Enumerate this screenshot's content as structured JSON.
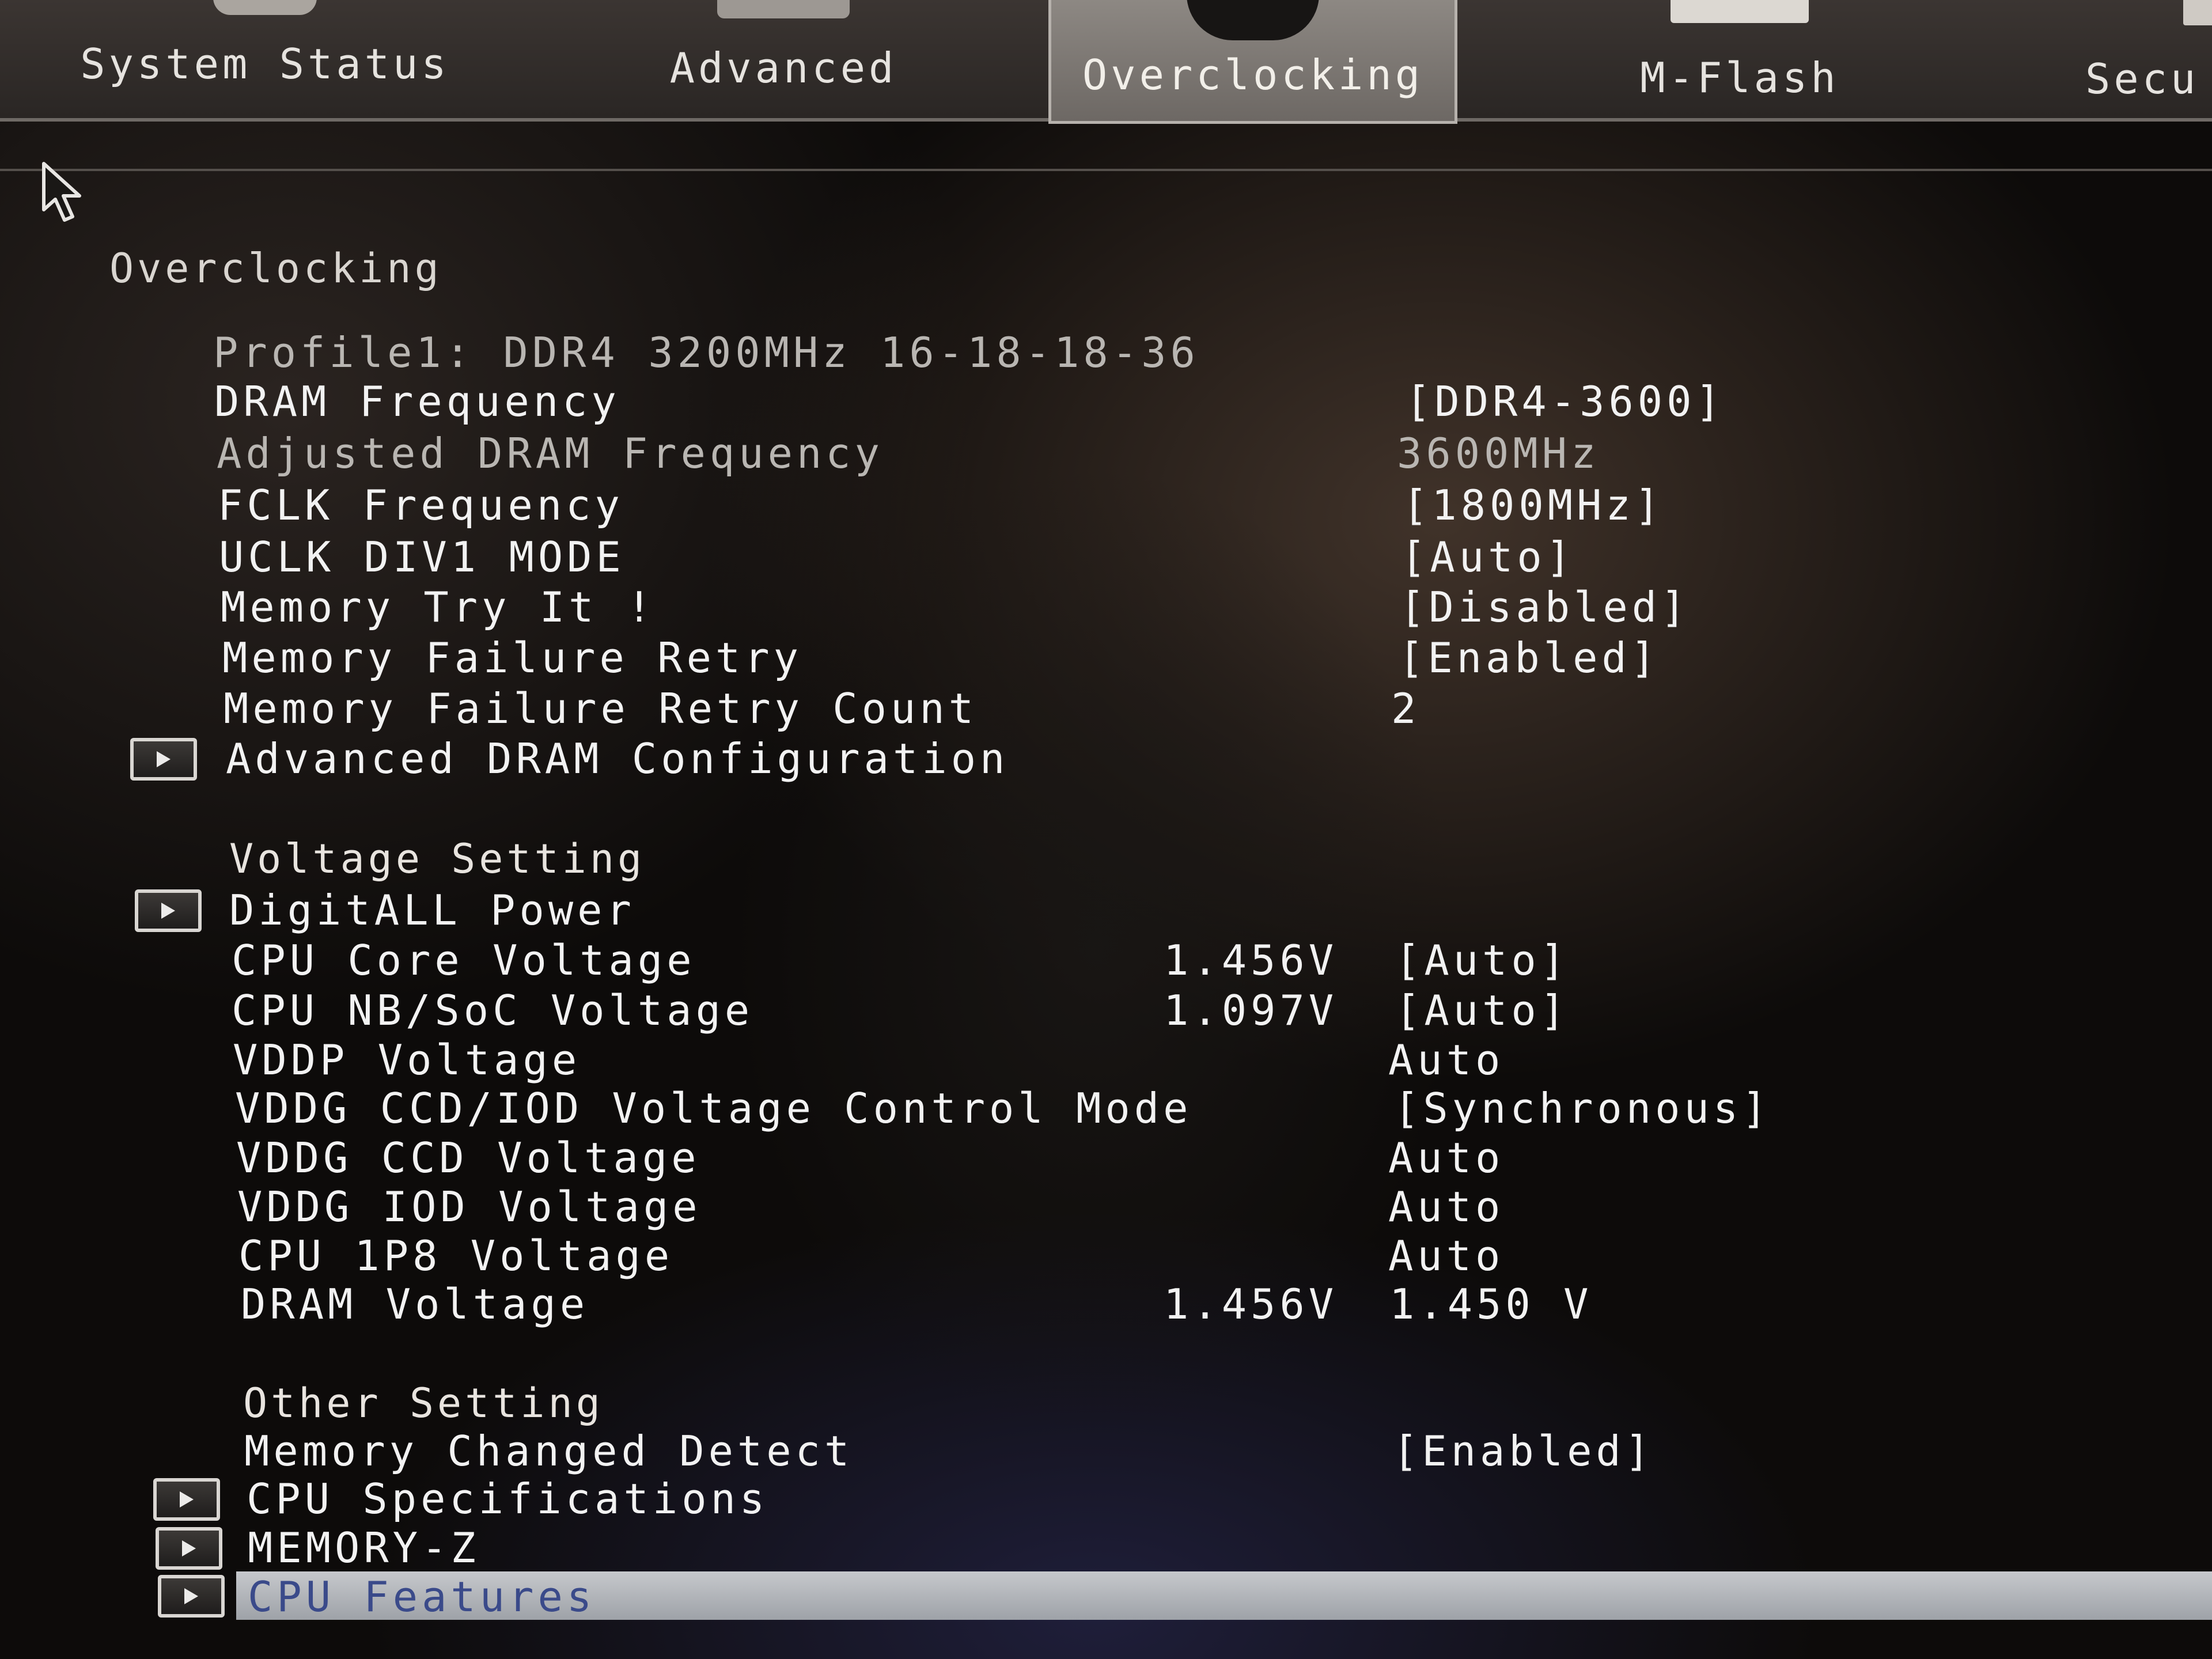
{
  "tabs": [
    {
      "label": "System Status",
      "icon": "status-icon"
    },
    {
      "label": "Advanced",
      "icon": "advanced-icon"
    },
    {
      "label": "Overclocking",
      "icon": "overclock-icon",
      "active": true
    },
    {
      "label": "M-Flash",
      "icon": "bios-chip-icon"
    },
    {
      "label": "Secu",
      "icon": "security-icon"
    }
  ],
  "section_title": "Overclocking",
  "profile_line": "Profile1: DDR4 3200MHz 16-18-18-36",
  "memory": {
    "dram_frequency": {
      "label": "DRAM Frequency",
      "value": "[DDR4-3600]"
    },
    "adjusted_dram": {
      "label": "Adjusted DRAM Frequency",
      "value": "3600MHz"
    },
    "fclk": {
      "label": "FCLK Frequency",
      "value": "[1800MHz]"
    },
    "uclk": {
      "label": "UCLK DIV1 MODE",
      "value": "[Auto]"
    },
    "try_it": {
      "label": "Memory Try It !",
      "value": "[Disabled]"
    },
    "failure_retry": {
      "label": "Memory Failure Retry",
      "value": "[Enabled]"
    },
    "failure_retry_count": {
      "label": "Memory Failure Retry Count",
      "value": "2"
    },
    "advanced_dram": {
      "label": "Advanced DRAM Configuration"
    }
  },
  "voltage": {
    "heading": "Voltage Setting",
    "digitall": {
      "label": "DigitALL Power"
    },
    "cpu_core": {
      "label": "CPU Core Voltage",
      "current": "1.456V",
      "value": "[Auto]"
    },
    "cpu_nb": {
      "label": "CPU NB/SoC Voltage",
      "current": "1.097V",
      "value": "[Auto]"
    },
    "vddp": {
      "label": "VDDP Voltage",
      "value": "Auto"
    },
    "vddg_mode": {
      "label": "VDDG CCD/IOD Voltage Control Mode",
      "value": "[Synchronous]"
    },
    "vddg_ccd": {
      "label": "VDDG CCD Voltage",
      "value": "Auto"
    },
    "vddg_iod": {
      "label": "VDDG IOD Voltage",
      "value": "Auto"
    },
    "cpu_1p8": {
      "label": "CPU 1P8 Voltage",
      "value": "Auto"
    },
    "dram": {
      "label": "DRAM Voltage",
      "current": "1.456V",
      "value": "1.450 V"
    }
  },
  "other": {
    "heading": "Other Setting",
    "mem_changed": {
      "label": "Memory Changed Detect",
      "value": "[Enabled]"
    },
    "cpu_specs": {
      "label": "CPU Specifications"
    },
    "memory_z": {
      "label": "MEMORY-Z"
    },
    "cpu_features": {
      "label": "CPU Features"
    }
  },
  "colors": {
    "highlight": "#b4b7bc",
    "highlight_text": "#3a4a8a",
    "text": "#f2f2f2",
    "dim_text": "#b9b6b2"
  }
}
